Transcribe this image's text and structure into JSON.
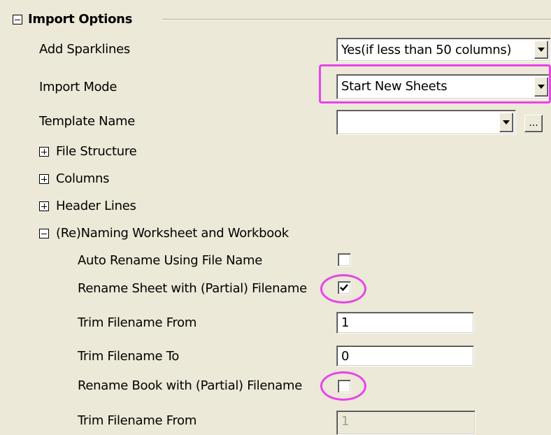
{
  "section": {
    "title": "Import Options"
  },
  "rows": {
    "add_sparklines": {
      "label": "Add Sparklines",
      "value": "Yes(if less than 50 columns)"
    },
    "import_mode": {
      "label": "Import Mode",
      "value": "Start New Sheets"
    },
    "template_name": {
      "label": "Template Name",
      "value": "",
      "browse_label": "..."
    }
  },
  "groups": {
    "file_structure": "File Structure",
    "columns": "Columns",
    "header_lines": "Header Lines",
    "renaming": "(Re)Naming Worksheet and Workbook"
  },
  "renaming": {
    "auto_rename": {
      "label": "Auto Rename Using File Name",
      "checked": false
    },
    "rename_sheet": {
      "label": "Rename Sheet with (Partial) Filename",
      "checked": true
    },
    "trim_from": {
      "label": "Trim Filename From",
      "value": "1"
    },
    "trim_to": {
      "label": "Trim Filename To",
      "value": "0"
    },
    "rename_book": {
      "label": "Rename Book with (Partial) Filename",
      "checked": false
    },
    "book_trim_from": {
      "label": "Trim Filename From",
      "value": "1"
    }
  },
  "colors": {
    "highlight": "#e844e8",
    "panel": "#ece9d8"
  }
}
